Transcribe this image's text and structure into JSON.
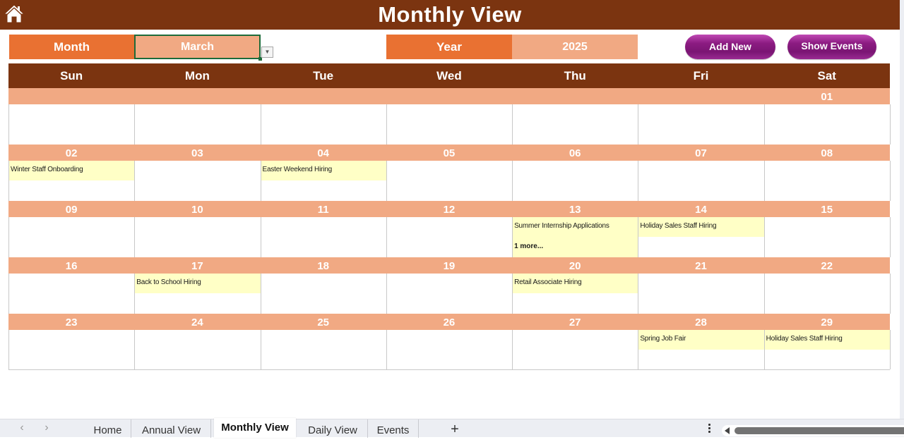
{
  "header": {
    "title": "Monthly View",
    "home_icon": "home-icon"
  },
  "controls": {
    "month_label": "Month",
    "month_value": "March",
    "year_label": "Year",
    "year_value": "2025",
    "dropdown_icon": "chevron-down-icon",
    "add_new_label": "Add New",
    "show_events_label": "Show Events"
  },
  "colors": {
    "title_bar": "#7b3410",
    "label_orange": "#e97132",
    "value_peach": "#f1a983",
    "event_highlight": "#ffffc6",
    "button_purple": "#8c1b82"
  },
  "calendar": {
    "days_of_week": [
      "Sun",
      "Mon",
      "Tue",
      "Wed",
      "Thu",
      "Fri",
      "Sat"
    ],
    "weeks": [
      {
        "dates": [
          "",
          "",
          "",
          "",
          "",
          "",
          "01"
        ],
        "events": [
          [],
          [],
          [],
          [],
          [],
          [],
          []
        ],
        "more": [
          "",
          "",
          "",
          "",
          "",
          "",
          ""
        ]
      },
      {
        "dates": [
          "02",
          "03",
          "04",
          "05",
          "06",
          "07",
          "08"
        ],
        "events": [
          [
            "Winter Staff Onboarding"
          ],
          [],
          [
            "Easter Weekend Hiring"
          ],
          [],
          [],
          [],
          []
        ],
        "more": [
          "",
          "",
          "",
          "",
          "",
          "",
          ""
        ]
      },
      {
        "dates": [
          "09",
          "10",
          "11",
          "12",
          "13",
          "14",
          "15"
        ],
        "events": [
          [],
          [],
          [],
          [],
          [
            "Summer Internship Applications"
          ],
          [
            "Holiday Sales Staff Hiring"
          ],
          []
        ],
        "more": [
          "",
          "",
          "",
          "",
          "1 more...",
          "",
          ""
        ]
      },
      {
        "dates": [
          "16",
          "17",
          "18",
          "19",
          "20",
          "21",
          "22"
        ],
        "events": [
          [],
          [
            "Back to School Hiring"
          ],
          [],
          [],
          [
            "Retail Associate Hiring"
          ],
          [],
          []
        ],
        "more": [
          "",
          "",
          "",
          "",
          "",
          "",
          ""
        ]
      },
      {
        "dates": [
          "23",
          "24",
          "25",
          "26",
          "27",
          "28",
          "29"
        ],
        "events": [
          [],
          [],
          [],
          [],
          [],
          [
            "Spring Job Fair"
          ],
          [
            "Holiday Sales Staff Hiring"
          ]
        ],
        "more": [
          "",
          "",
          "",
          "",
          "",
          "",
          ""
        ]
      }
    ]
  },
  "tabbar": {
    "prev_icon": "chevron-left-icon",
    "next_icon": "chevron-right-icon",
    "prev_glyph": "‹",
    "next_glyph": "›",
    "tabs": [
      {
        "label": "Home",
        "active": false
      },
      {
        "label": "Annual View",
        "active": false
      },
      {
        "label": "Monthly View",
        "active": true
      },
      {
        "label": "Daily View",
        "active": false
      },
      {
        "label": "Events",
        "active": false
      }
    ],
    "add_sheet_glyph": "+"
  }
}
